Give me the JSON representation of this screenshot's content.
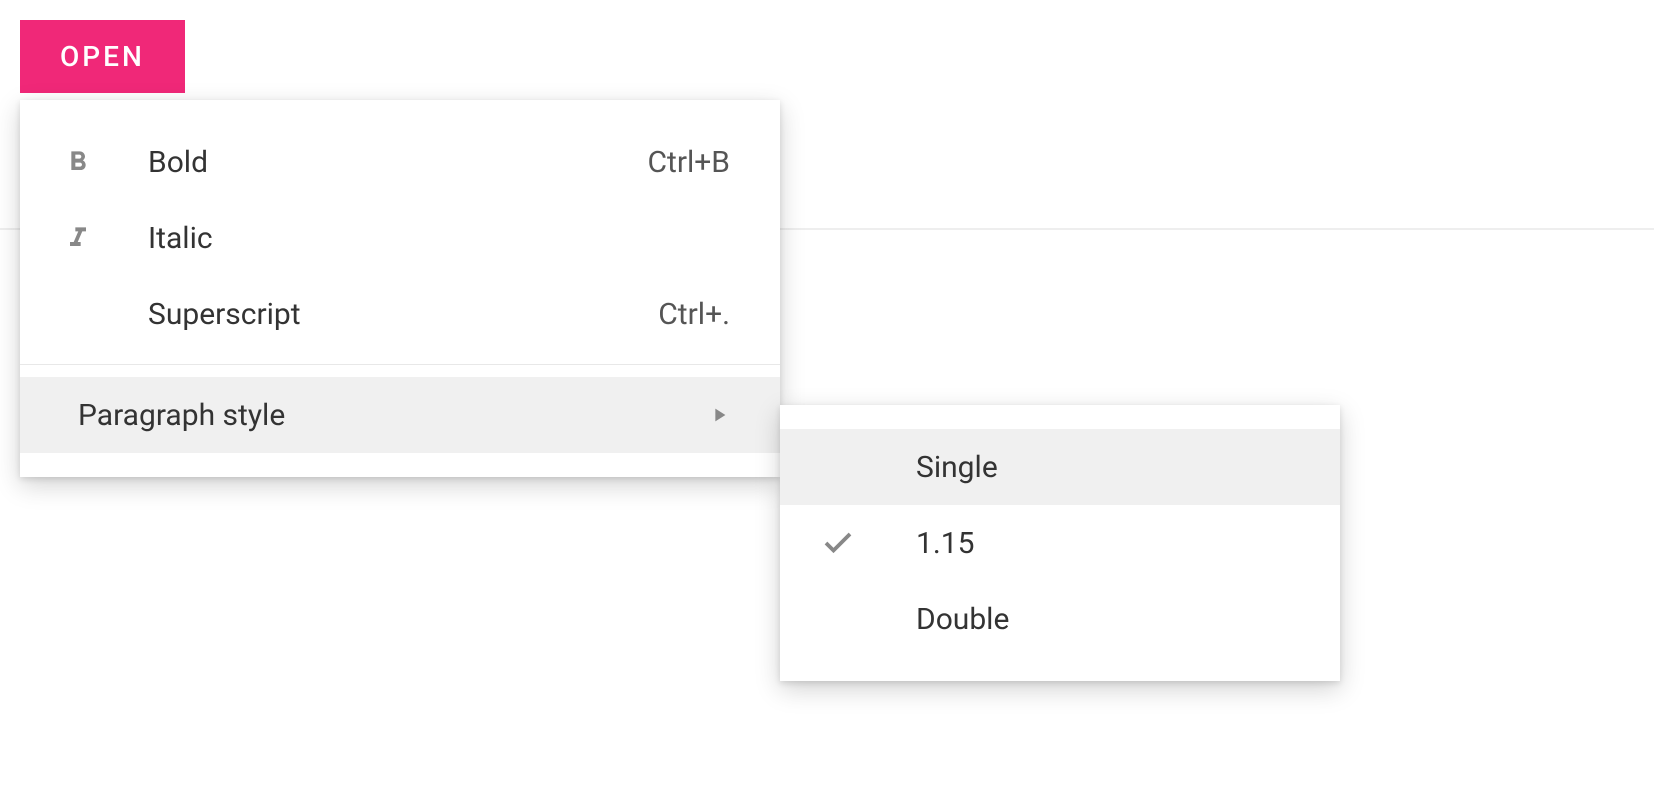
{
  "button": {
    "open_label": "OPEN"
  },
  "menu": {
    "items": [
      {
        "icon": "bold-icon",
        "label": "Bold",
        "shortcut": "Ctrl+B"
      },
      {
        "icon": "italic-icon",
        "label": "Italic",
        "shortcut": ""
      },
      {
        "icon": "",
        "label": "Superscript",
        "shortcut": "Ctrl+."
      }
    ],
    "paragraph_style": {
      "label": "Paragraph style"
    }
  },
  "submenu": {
    "items": [
      {
        "label": "Single",
        "checked": false,
        "highlighted": true
      },
      {
        "label": "1.15",
        "checked": true,
        "highlighted": false
      },
      {
        "label": "Double",
        "checked": false,
        "highlighted": false
      }
    ]
  }
}
